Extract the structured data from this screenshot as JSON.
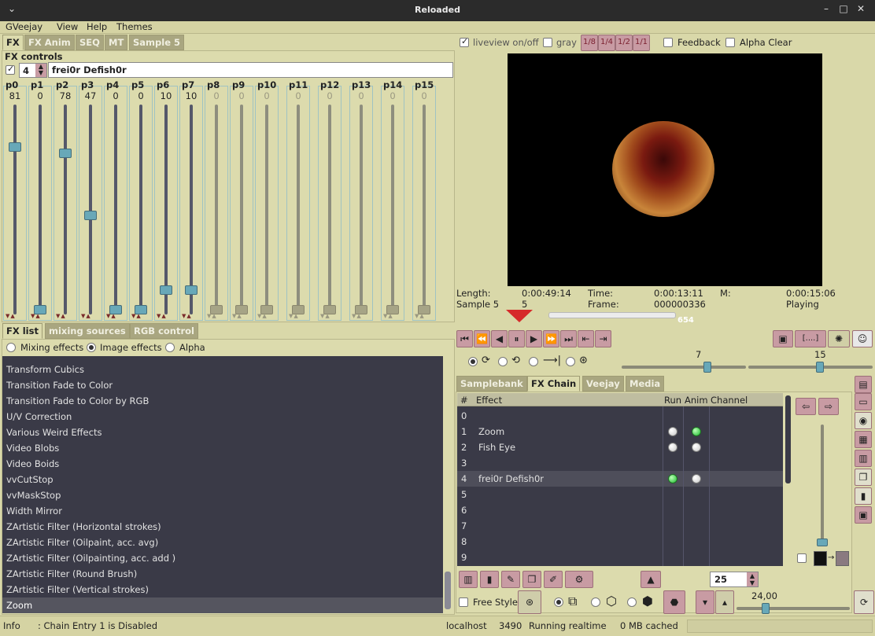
{
  "window": {
    "title": "Reloaded",
    "icon": "chevron-down-icon",
    "buttons": [
      "–",
      "□",
      "✕"
    ]
  },
  "menu": [
    "GVeejay",
    "View",
    "Help",
    "Themes"
  ],
  "left_tabs": [
    "FX",
    "FX Anim",
    "SEQ",
    "MT",
    "Sample 5"
  ],
  "fx_controls": {
    "title": "FX controls",
    "entry": "4",
    "effect_name": "frei0r Defish0r",
    "params": [
      {
        "label": "p0",
        "value": "81",
        "level": 0.81,
        "enabled": true
      },
      {
        "label": "p1",
        "value": "0",
        "level": 0,
        "enabled": true
      },
      {
        "label": "p2",
        "value": "78",
        "level": 0.78,
        "enabled": true
      },
      {
        "label": "p3",
        "value": "47",
        "level": 0.47,
        "enabled": true
      },
      {
        "label": "p4",
        "value": "0",
        "level": 0,
        "enabled": true
      },
      {
        "label": "p5",
        "value": "0",
        "level": 0,
        "enabled": true
      },
      {
        "label": "p6",
        "value": "10",
        "level": 0.1,
        "enabled": true
      },
      {
        "label": "p7",
        "value": "10",
        "level": 0.1,
        "enabled": true
      },
      {
        "label": "p8",
        "value": "0",
        "level": 0,
        "enabled": false
      },
      {
        "label": "p9",
        "value": "0",
        "level": 0,
        "enabled": false
      },
      {
        "label": "p10",
        "value": "0",
        "level": 0,
        "enabled": false
      },
      {
        "label": "p11",
        "value": "0",
        "level": 0,
        "enabled": false
      },
      {
        "label": "p12",
        "value": "0",
        "level": 0,
        "enabled": false
      },
      {
        "label": "p13",
        "value": "0",
        "level": 0,
        "enabled": false
      },
      {
        "label": "p14",
        "value": "0",
        "level": 0,
        "enabled": false
      },
      {
        "label": "p15",
        "value": "0",
        "level": 0,
        "enabled": false
      }
    ]
  },
  "bottom_tabs": [
    "FX list",
    "mixing sources",
    "RGB control"
  ],
  "effect_filters": {
    "mixing": "Mixing effects",
    "image": "Image effects",
    "alpha": "Alpha"
  },
  "fx_list": [
    "Transform Cubics",
    "Transition Fade to Color",
    "Transition Fade to Color by RGB",
    "U/V Correction",
    "Various Weird Effects",
    "Video Blobs",
    "Video Boids",
    "vvCutStop",
    "vvMaskStop",
    "Width Mirror",
    "ZArtistic Filter (Horizontal strokes)",
    "ZArtistic Filter (Oilpaint, acc. avg)",
    "ZArtistic Filter (Oilpainting, acc. add )",
    "ZArtistic Filter (Round Brush)",
    "ZArtistic Filter (Vertical strokes)",
    "Zoom"
  ],
  "fx_list_selected": "Zoom",
  "top_right": {
    "liveview": "liveview on/off",
    "gray": "gray",
    "scales": [
      "1/8",
      "1/4",
      "1/2",
      "1/1"
    ],
    "feedback": "Feedback",
    "alpha_clear": "Alpha Clear"
  },
  "info": {
    "length_label": "Length:",
    "length": "0:00:49:14",
    "time_label": "Time:",
    "time": "0:00:13:11",
    "m_label": "M:",
    "m": "0:00:15:06",
    "sample_label": "Sample 5",
    "sample_no": "5",
    "frame_label": "Frame:",
    "frame": "000000336",
    "state": "Playing"
  },
  "timeline": {
    "frames": "654",
    "position": 0.51
  },
  "transport": [
    "⏮",
    "⏪",
    "◀",
    "⏸",
    "▶",
    "⏩",
    "⏭",
    "⇤",
    "⇥"
  ],
  "speed": {
    "value1": "7",
    "value2": "15",
    "level1": 0.7,
    "level2": 0.58
  },
  "right_tabs": [
    "Samplebank",
    "FX Chain",
    "Veejay",
    "Media"
  ],
  "chain": {
    "headers": [
      "#",
      "Effect",
      "Run",
      "Anim",
      "Channel"
    ],
    "rows": [
      {
        "n": "0",
        "effect": "",
        "run": null,
        "anim": null
      },
      {
        "n": "1",
        "effect": "Zoom",
        "run": "off",
        "anim": "on"
      },
      {
        "n": "2",
        "effect": "Fish Eye",
        "run": "off",
        "anim": "off"
      },
      {
        "n": "3",
        "effect": "",
        "run": null,
        "anim": null
      },
      {
        "n": "4",
        "effect": "frei0r Defish0r",
        "run": "on",
        "anim": "off",
        "selected": true
      },
      {
        "n": "5",
        "effect": ""
      },
      {
        "n": "6",
        "effect": ""
      },
      {
        "n": "7",
        "effect": ""
      },
      {
        "n": "8",
        "effect": ""
      },
      {
        "n": "9",
        "effect": ""
      }
    ]
  },
  "chain_spin": "25",
  "bottom": {
    "free_style": "Free Style",
    "opacity": "24,00",
    "opacity_level": 0.24
  },
  "status": {
    "info": "Info",
    "message": ": Chain Entry 1 is Disabled",
    "host": "localhost",
    "port": "3490",
    "mode": "Running realtime",
    "cache": "0 MB cached"
  },
  "colors": {
    "bg": "#d9d8a9",
    "tab_inactive": "#a9a680",
    "list_bg": "#3a3a47",
    "accent": "#c89ba3",
    "handle": "#68a8b8"
  }
}
